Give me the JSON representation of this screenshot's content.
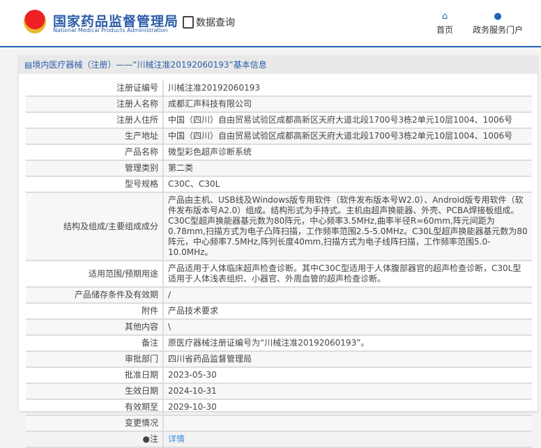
{
  "header": {
    "logo_cn": "国家药品监督管理局",
    "logo_en": "National Medical Products Administration",
    "query": "数据查询",
    "nav": [
      {
        "label": "首页",
        "icon": "home-icon"
      },
      {
        "label": "政务服务门户",
        "icon": "user-icon"
      }
    ]
  },
  "panel": {
    "title": "境内医疗器械（注册）——“川械注准20192060193”基本信息"
  },
  "rows": [
    {
      "label": "注册证编号",
      "value": "川械注准20192060193"
    },
    {
      "label": "注册人名称",
      "value": "成都汇声科技有限公司"
    },
    {
      "label": "注册人住所",
      "value": "中国（四川）自由贸易试验区成都高新区天府大道北段1700号3栋2单元10层1004、1006号"
    },
    {
      "label": "生产地址",
      "value": "中国（四川）自由贸易试验区成都高新区天府大道北段1700号3栋2单元10层1004、1006号"
    },
    {
      "label": "产品名称",
      "value": "微型彩色超声诊断系统"
    },
    {
      "label": "管理类别",
      "value": "第二类"
    },
    {
      "label": "型号规格",
      "value": "C30C、C30L"
    },
    {
      "label": "结构及组成/主要组成成分",
      "value": "产品由主机、USB线及Windows版专用软件（软件发布版本号W2.0）、Android版专用软件（软件发布版本号A2.0）组成。结构形式为手持式。主机由超声换能器、外壳、PCBA焊接板组成。C30C型超声换能器基元数为80阵元，中心频率3.5MHz,曲率半径R=60mm,阵元间距为0.78mm,扫描方式为电子凸阵扫描，工作频率范围2.5-5.0MHz。C30L型超声换能器基元数为80阵元，中心频率7.5MHz,阵列长度40mm,扫描方式为电子线阵扫描，工作频率范围5.0-10.0MHz。"
    },
    {
      "label": "适用范围/预期用途",
      "value": "产品适用于人体临床超声检查诊断。其中C30C型适用于人体腹部器官的超声检查诊断，C30L型适用于人体浅表组织、小器官、外周血管的超声检查诊断。"
    },
    {
      "label": "产品储存条件及有效期",
      "value": "/"
    },
    {
      "label": "附件",
      "value": "产品技术要求"
    },
    {
      "label": "其他内容",
      "value": "\\"
    },
    {
      "label": "备注",
      "value": "原医疗器械注册证编号为“川械注准20192060193”。"
    },
    {
      "label": "审批部门",
      "value": "四川省药品监督管理局"
    },
    {
      "label": "批准日期",
      "value": "2023-05-30"
    },
    {
      "label": "生效日期",
      "value": "2024-10-31"
    },
    {
      "label": "有效期至",
      "value": "2029-10-30"
    },
    {
      "label": "变更情况",
      "value": ""
    }
  ],
  "note": {
    "label": "注",
    "link": "详情"
  }
}
